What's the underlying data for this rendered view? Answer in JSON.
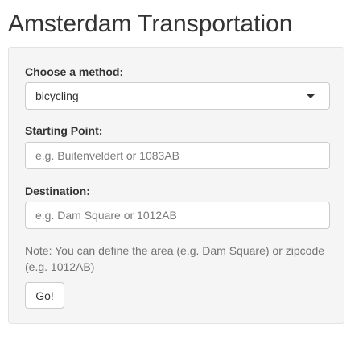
{
  "app": {
    "title": "Amsterdam Transportation"
  },
  "form": {
    "method": {
      "label": "Choose a method:",
      "selected": "bicycling"
    },
    "start": {
      "label": "Starting Point:",
      "value": "",
      "placeholder": "e.g. Buitenveldert or 1083AB"
    },
    "destination": {
      "label": "Destination:",
      "value": "",
      "placeholder": "e.g. Dam Square or 1012AB"
    },
    "note": "Note: You can define the area (e.g. Dam Square) or zipcode (e.g. 1012AB)",
    "submit_label": "Go!"
  },
  "icons": {
    "select_caret": "chevron-down-icon"
  },
  "colors": {
    "panel_background": "#f5f5f5",
    "panel_border": "#e3e3e3",
    "input_border": "#cccccc",
    "text": "#333333",
    "help_text": "#737373"
  }
}
